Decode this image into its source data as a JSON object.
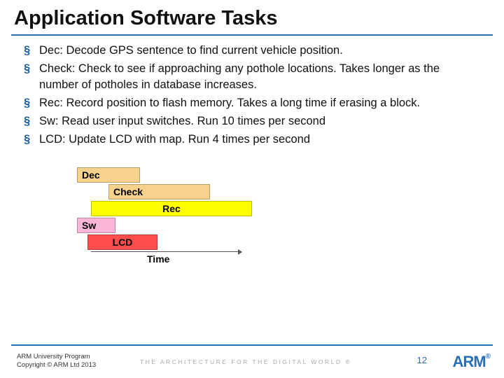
{
  "title": "Application Software Tasks",
  "bullets": [
    "Dec: Decode GPS sentence to find current vehicle position.",
    "Check: Check to see if approaching any pothole locations. Takes longer as the number of potholes in database increases.",
    "Rec: Record position to flash memory. Takes a long time if erasing a block.",
    "Sw: Read user input switches. Run 10 times per second",
    "LCD: Update LCD with map. Run 4 times per second"
  ],
  "chart": {
    "tasks": {
      "dec": "Dec",
      "check": "Check",
      "rec": "Rec",
      "sw": "Sw",
      "lcd": "LCD"
    },
    "axis": "Time"
  },
  "footer": {
    "line1": "ARM University Program",
    "line2": "Copyright © ARM Ltd 2013",
    "tagline": "THE ARCHITECTURE FOR THE DIGITAL WORLD ®"
  },
  "page": "12",
  "logo": "ARM"
}
